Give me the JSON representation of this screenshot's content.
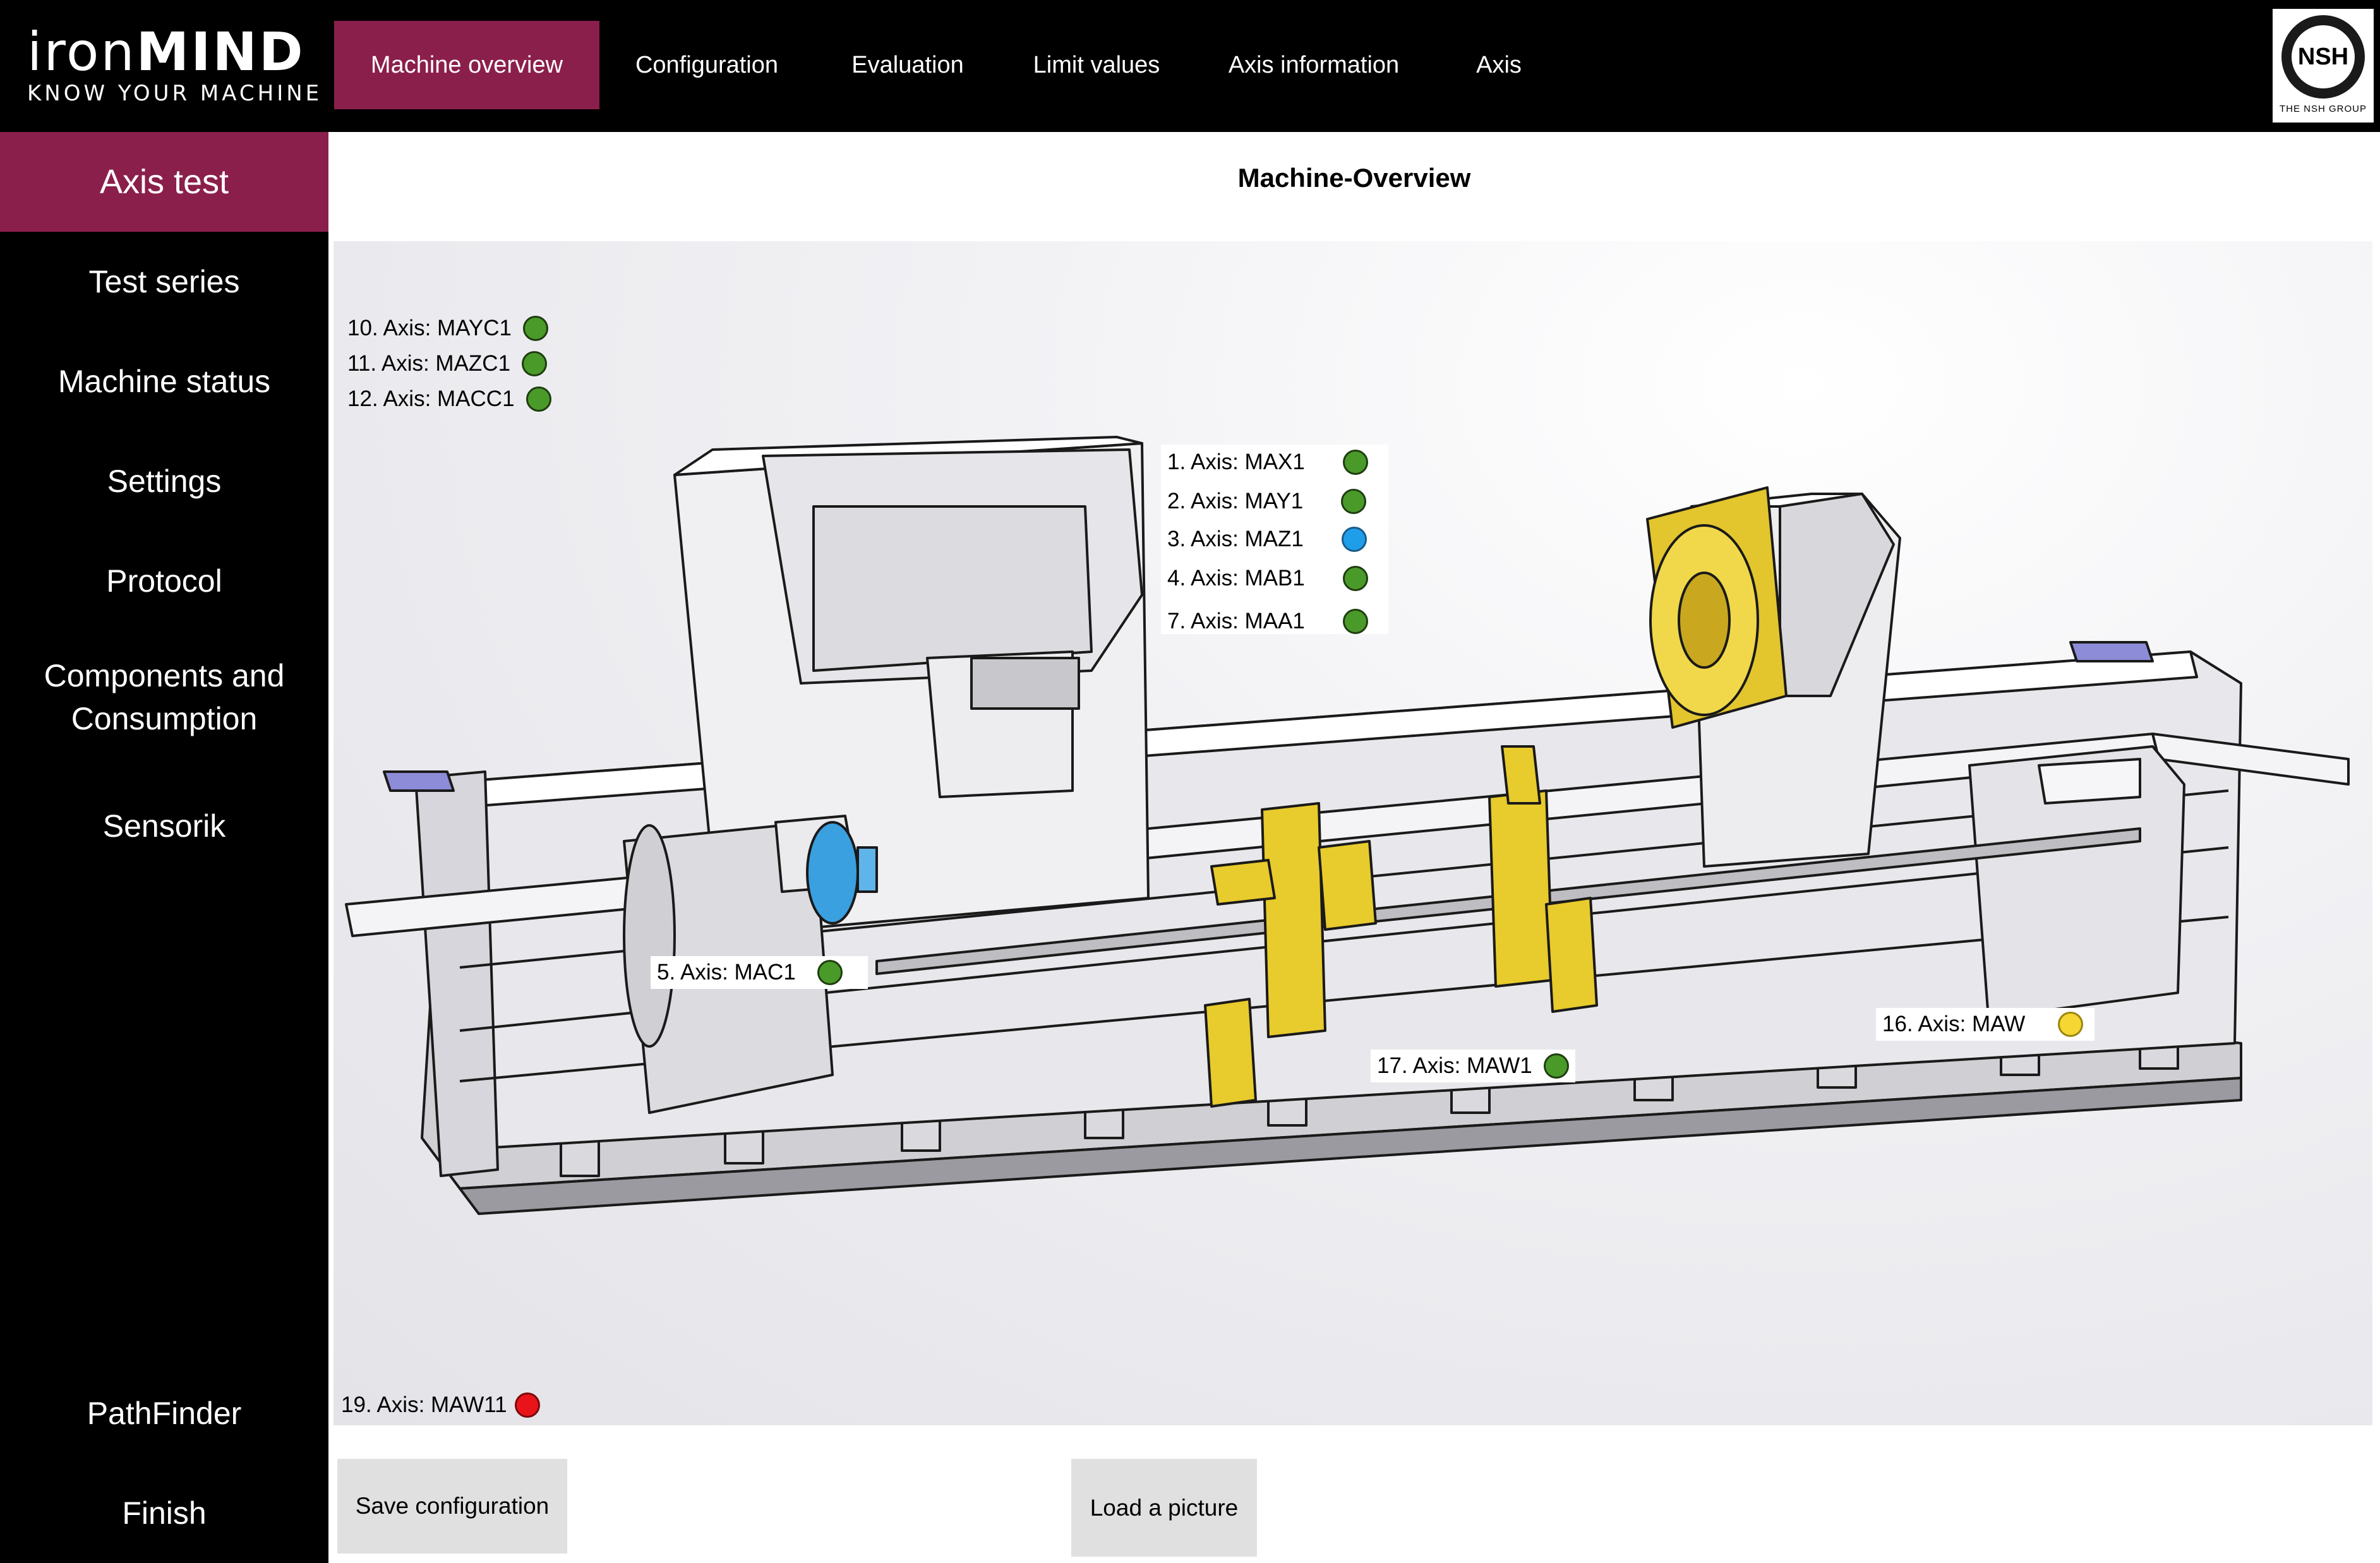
{
  "brand": {
    "logo_light": "iron",
    "logo_bold": "MIND",
    "tagline": "KNOW YOUR MACHINE",
    "partner_logo": "NSH",
    "partner_tagline": "THE NSH GROUP"
  },
  "nav": {
    "tabs": [
      {
        "label": "Machine overview",
        "active": true
      },
      {
        "label": "Configuration"
      },
      {
        "label": "Evaluation"
      },
      {
        "label": "Limit values"
      },
      {
        "label": "Axis information"
      },
      {
        "label": "Axis"
      }
    ]
  },
  "sidebar": {
    "items": [
      {
        "label": "Axis test",
        "active": true
      },
      {
        "label": "Test series"
      },
      {
        "label": "Machine status"
      },
      {
        "label": "Settings"
      },
      {
        "label": "Protocol"
      },
      {
        "label": "Components and Consumption"
      },
      {
        "label": "Sensorik"
      },
      {
        "label": "PathFinder"
      },
      {
        "label": "Finish"
      }
    ]
  },
  "main": {
    "title": "Machine-Overview"
  },
  "status_colors": {
    "ok": "#4a9a2a",
    "info": "#1e9ee8",
    "warning": "#f5d633",
    "error": "#e8141a"
  },
  "axes": [
    {
      "label": "10. Axis: MAYC1",
      "status": "ok"
    },
    {
      "label": "11. Axis: MAZC1",
      "status": "ok"
    },
    {
      "label": "12. Axis: MACC1",
      "status": "ok"
    },
    {
      "label": "1. Axis: MAX1",
      "status": "ok"
    },
    {
      "label": "2. Axis: MAY1",
      "status": "ok"
    },
    {
      "label": "3. Axis: MAZ1",
      "status": "info"
    },
    {
      "label": "4. Axis: MAB1",
      "status": "ok"
    },
    {
      "label": "7. Axis: MAA1",
      "status": "ok"
    },
    {
      "label": "5. Axis: MAC1",
      "status": "ok"
    },
    {
      "label": "17. Axis: MAW1",
      "status": "ok"
    },
    {
      "label": "16. Axis: MAW",
      "status": "warning"
    },
    {
      "label": "19. Axis: MAW11",
      "status": "error"
    }
  ],
  "buttons": {
    "save": "Save configuration",
    "load": "Load a picture"
  }
}
